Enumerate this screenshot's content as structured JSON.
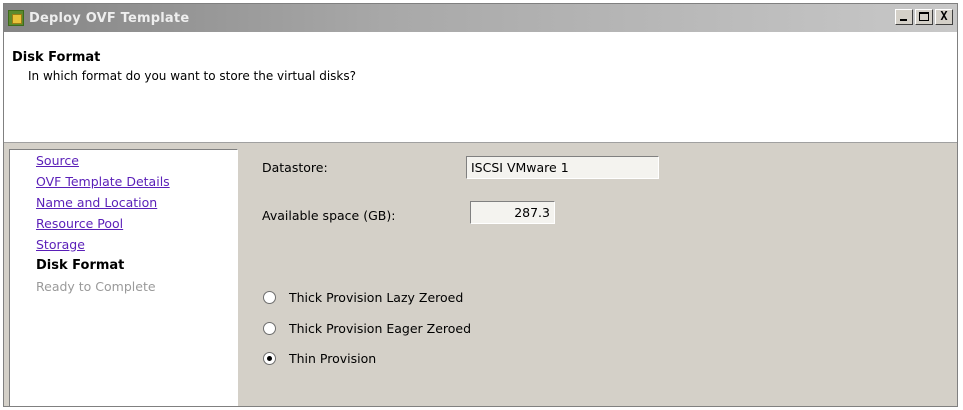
{
  "window": {
    "title": "Deploy OVF Template",
    "controls": {
      "minimize": "_",
      "maximize": "□",
      "close": "X"
    }
  },
  "header": {
    "title": "Disk Format",
    "subtitle": "In which format do you want to store the virtual disks?"
  },
  "nav": {
    "items": [
      {
        "label": "Source",
        "state": "link"
      },
      {
        "label": "OVF Template Details",
        "state": "link"
      },
      {
        "label": "Name and Location",
        "state": "link"
      },
      {
        "label": "Resource Pool",
        "state": "link"
      },
      {
        "label": "Storage",
        "state": "link"
      },
      {
        "label": "Disk Format",
        "state": "current"
      },
      {
        "label": "Ready to Complete",
        "state": "disabled"
      }
    ]
  },
  "form": {
    "datastore_label": "Datastore:",
    "datastore_value": "ISCSI VMware 1",
    "space_label": "Available space (GB):",
    "space_value": "287.3",
    "options": [
      {
        "label": "Thick Provision Lazy Zeroed",
        "checked": false
      },
      {
        "label": "Thick Provision Eager Zeroed",
        "checked": false
      },
      {
        "label": "Thin Provision",
        "checked": true
      }
    ]
  },
  "colors": {
    "link": "#5a1fb8",
    "window_bg": "#d4d0c8",
    "disabled_text": "#9a9a9a"
  }
}
